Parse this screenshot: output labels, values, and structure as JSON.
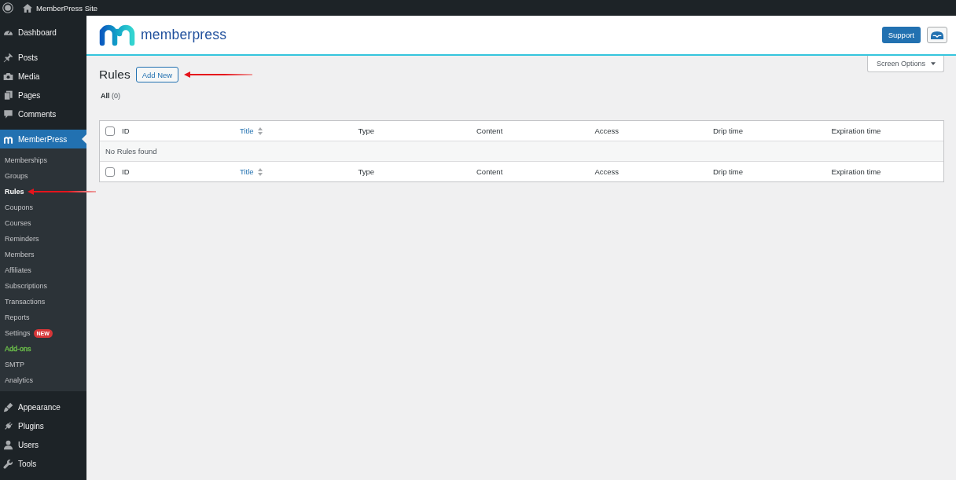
{
  "admin_bar": {
    "site_name": "MemberPress Site"
  },
  "sidebar": {
    "groups": [
      {
        "items": [
          {
            "label": "Dashboard",
            "selected": false
          }
        ]
      },
      {
        "items": [
          {
            "label": "Posts",
            "selected": false
          },
          {
            "label": "Media",
            "selected": false
          },
          {
            "label": "Pages",
            "selected": false
          },
          {
            "label": "Comments",
            "selected": false
          }
        ]
      },
      {
        "items": [
          {
            "label": "MemberPress",
            "selected": true,
            "children": [
              {
                "label": "Memberships",
                "selected": false
              },
              {
                "label": "Groups",
                "selected": false
              },
              {
                "label": "Rules",
                "selected": true,
                "arrow_marked": true
              },
              {
                "label": "Coupons",
                "selected": false
              },
              {
                "label": "Courses",
                "selected": false
              },
              {
                "label": "Reminders",
                "selected": false
              },
              {
                "label": "Members",
                "selected": false
              },
              {
                "label": "Affiliates",
                "selected": false
              },
              {
                "label": "Subscriptions",
                "selected": false
              },
              {
                "label": "Transactions",
                "selected": false
              },
              {
                "label": "Reports",
                "selected": false
              },
              {
                "label": "Settings",
                "selected": false,
                "badge": "NEW"
              },
              {
                "label": "Add-ons",
                "selected": false,
                "color": "#6cc04a"
              },
              {
                "label": "SMTP",
                "selected": false
              },
              {
                "label": "Analytics",
                "selected": false
              }
            ]
          }
        ]
      },
      {
        "items": [
          {
            "label": "Appearance",
            "selected": false
          },
          {
            "label": "Plugins",
            "selected": false
          },
          {
            "label": "Users",
            "selected": false
          },
          {
            "label": "Tools",
            "selected": false
          }
        ]
      }
    ]
  },
  "header": {
    "brand": "memberpress",
    "support_button": "Support"
  },
  "screen_options": {
    "label": "Screen Options",
    "expanded": false
  },
  "page": {
    "title": "Rules",
    "add_new": {
      "label": "Add New",
      "arrow_marked": true
    },
    "views": [
      {
        "label": "All",
        "count": "(0)",
        "selected": true
      }
    ]
  },
  "table": {
    "header": {
      "checked": false,
      "columns": [
        {
          "label": "ID",
          "sortable": false
        },
        {
          "label": "Title",
          "sortable": true
        },
        {
          "label": "Type",
          "sortable": false
        },
        {
          "label": "Content",
          "sortable": false
        },
        {
          "label": "Access",
          "sortable": false
        },
        {
          "label": "Drip time",
          "sortable": false
        },
        {
          "label": "Expiration time",
          "sortable": false
        }
      ]
    },
    "empty_message": "No Rules found",
    "footer": {
      "checked": false,
      "columns": [
        {
          "label": "ID",
          "sortable": false
        },
        {
          "label": "Title",
          "sortable": true
        },
        {
          "label": "Type",
          "sortable": false
        },
        {
          "label": "Content",
          "sortable": false
        },
        {
          "label": "Access",
          "sortable": false
        },
        {
          "label": "Drip time",
          "sortable": false
        },
        {
          "label": "Expiration time",
          "sortable": false
        }
      ]
    }
  }
}
